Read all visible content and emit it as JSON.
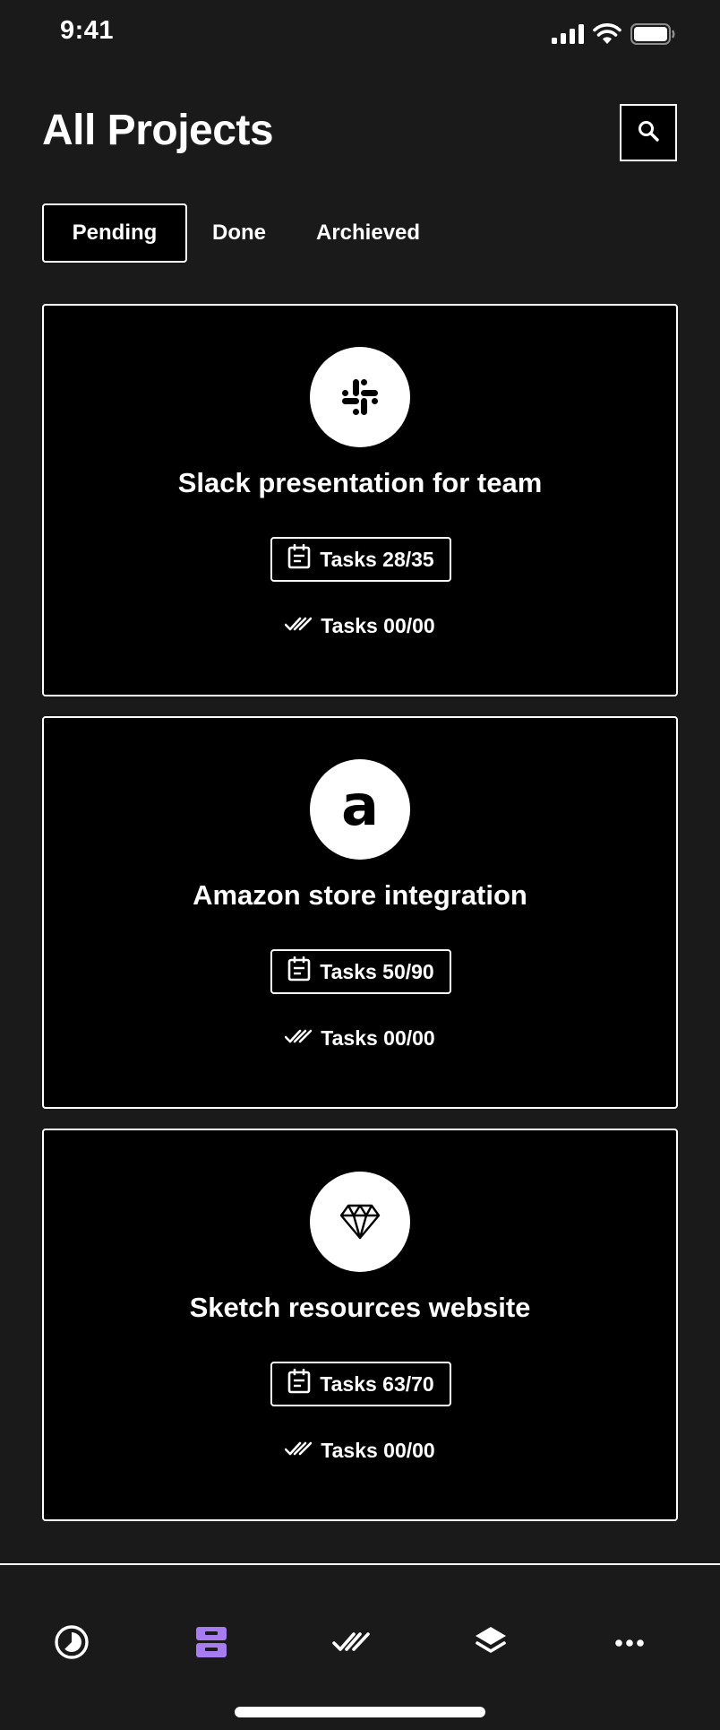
{
  "status_bar": {
    "time": "9:41",
    "icons": [
      "cellular-signal-icon",
      "wifi-icon",
      "battery-icon"
    ]
  },
  "header": {
    "title": "All Projects",
    "search_icon": "search-icon"
  },
  "tabs": [
    {
      "label": "Pending",
      "active": true
    },
    {
      "label": "Done",
      "active": false
    },
    {
      "label": "Archieved",
      "active": false
    }
  ],
  "projects": [
    {
      "logo": "slack-logo",
      "title": "Slack presentation for team",
      "tasks_label": "Tasks 28/35",
      "done_label": "Tasks 00/00"
    },
    {
      "logo": "amazon-logo",
      "logo_text": "a",
      "title": "Amazon store integration",
      "tasks_label": "Tasks 50/90",
      "done_label": "Tasks 00/00"
    },
    {
      "logo": "sketch-diamond-logo",
      "title": "Sketch resources website",
      "tasks_label": "Tasks 63/70",
      "done_label": "Tasks 00/00"
    }
  ],
  "bottom_nav": {
    "items": [
      {
        "icon": "dashboard-clock-icon",
        "active": false
      },
      {
        "icon": "inbox-tray-icon",
        "active": true
      },
      {
        "icon": "double-check-icon",
        "active": false
      },
      {
        "icon": "layers-icon",
        "active": false
      },
      {
        "icon": "more-dots-icon",
        "active": false
      }
    ],
    "active_color": "#a67cf0",
    "icon_color": "#ffffff"
  },
  "colors": {
    "background": "#1a1a1a",
    "card_background": "#000000",
    "foreground": "#ffffff",
    "accent": "#a67cf0"
  }
}
